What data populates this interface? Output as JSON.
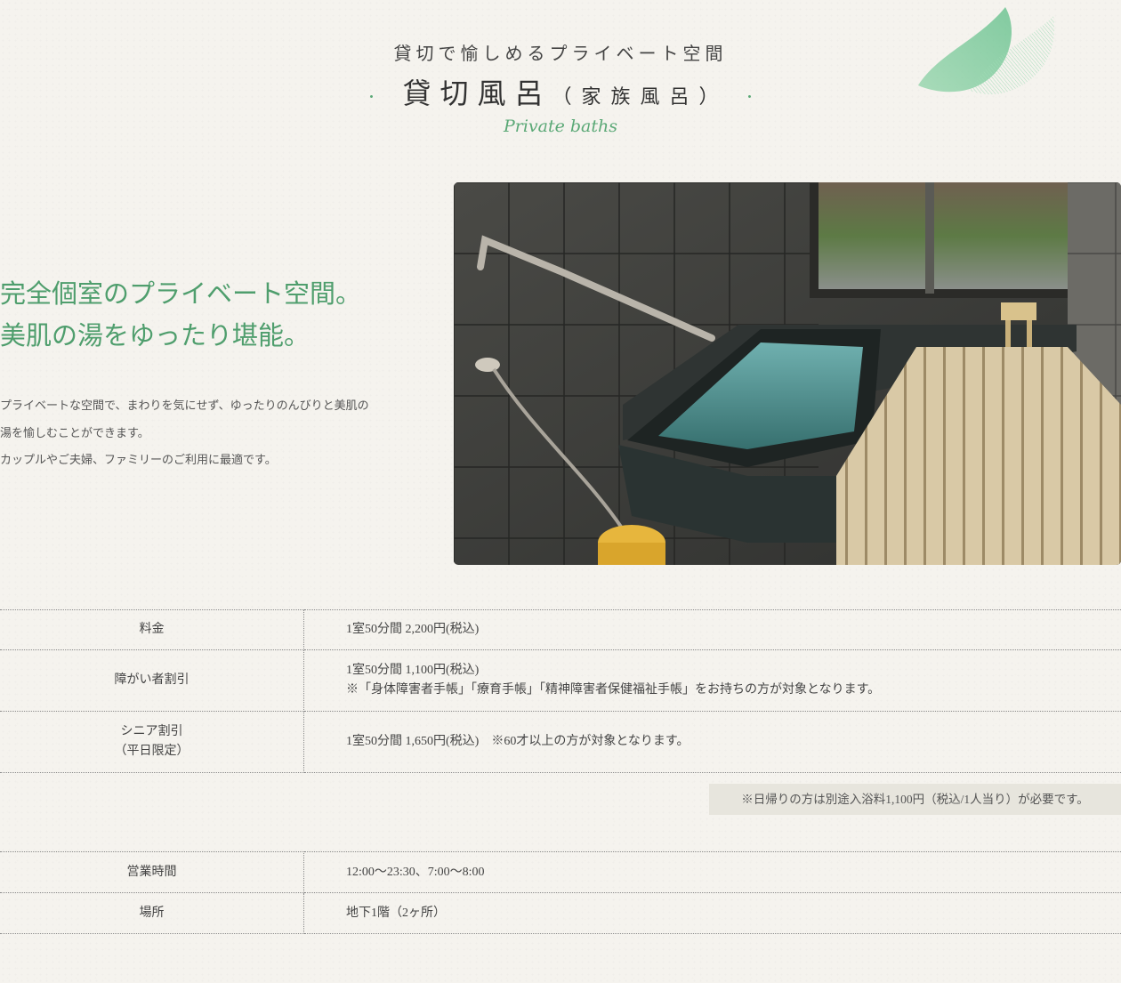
{
  "header": {
    "subtitle": "貸切で愉しめるプライベート空間",
    "title": "貸切風呂",
    "title_paren": "（家族風呂）",
    "dot_left": "・",
    "dot_right": "・",
    "english": "Private baths"
  },
  "intro": {
    "catch_line1": "完全個室のプライベート空間。",
    "catch_line2": "美肌の湯をゆったり堪能。",
    "desc_line1": "プライベートな空間で、まわりを気にせず、ゆったりのんびりと美肌の",
    "desc_line2": "湯を愉しむことができます。",
    "desc_line3": "カップルやご夫婦、ファミリーのご利用に最適です。"
  },
  "pricing": {
    "rows": [
      {
        "label": "料金",
        "value_line1": "1室50分間 2,200円(税込)"
      },
      {
        "label": "障がい者割引",
        "value_line1": "1室50分間 1,100円(税込)",
        "value_line2": "※「身体障害者手帳」「療育手帳」「精神障害者保健福祉手帳」をお持ちの方が対象となります。"
      },
      {
        "label_line1": "シニア割引",
        "label_line2": "（平日限定）",
        "value_line1": "1室50分間 1,650円(税込)　※60才以上の方が対象となります。"
      }
    ]
  },
  "note": "※日帰りの方は別途入浴料1,100円（税込/1人当り）が必要です。",
  "hours": {
    "rows": [
      {
        "label": "営業時間",
        "value": "12:00～23:30、7:00～8:00"
      },
      {
        "label": "場所",
        "value": "地下1階（2ヶ所）"
      }
    ]
  },
  "colors": {
    "accent_green": "#5aa876",
    "background": "#f5f3ee",
    "note_bg": "#e7e5dd"
  },
  "icons": {
    "leaf": "leaf-decoration-icon"
  }
}
